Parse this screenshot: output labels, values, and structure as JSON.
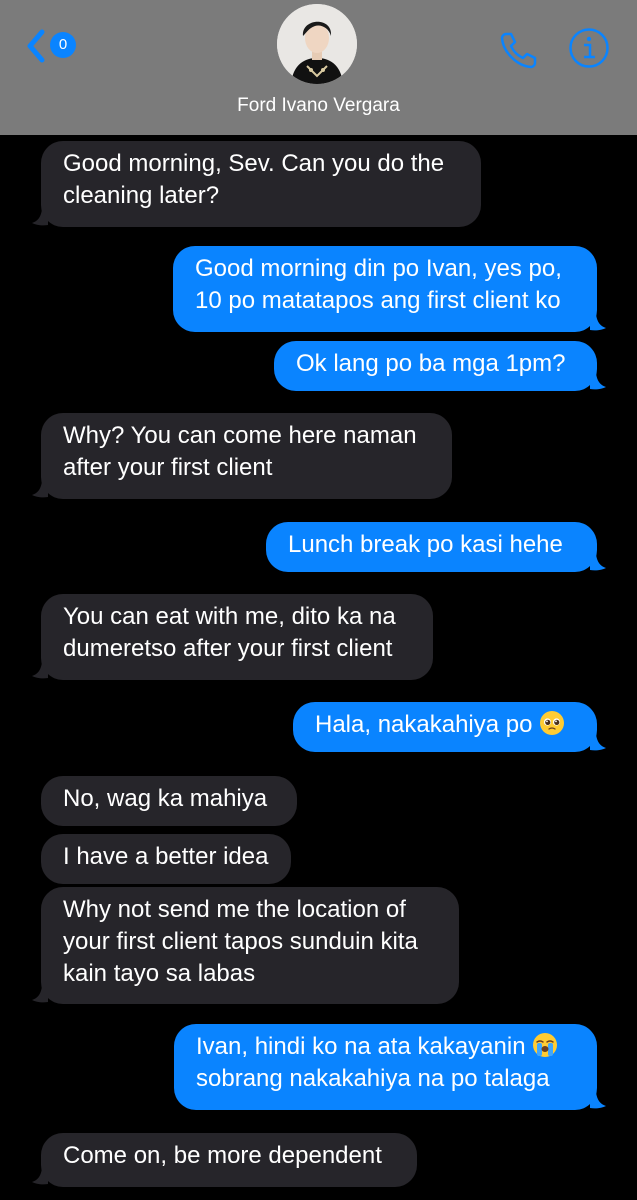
{
  "header": {
    "back_badge": "0",
    "contact_name": "Ford Ivano Vergara"
  },
  "icons": {
    "back": "chevron-left-icon",
    "call": "phone-icon",
    "info": "info-icon",
    "pleading": "pleading-face-emoji",
    "crying": "loudly-crying-face-emoji"
  },
  "colors": {
    "header_bg": "#7b7b7b",
    "incoming_bubble": "#26252a",
    "outgoing_bubble": "#0a84ff",
    "accent": "#0a84ff",
    "background": "#000000"
  },
  "messages": [
    {
      "direction": "incoming",
      "lines": [
        "Good morning, Sev. Can you do the",
        "cleaning later?"
      ]
    },
    {
      "direction": "outgoing",
      "lines": [
        "Good morning din po Ivan, yes po,",
        "10 po matatapos ang first client ko"
      ]
    },
    {
      "direction": "outgoing",
      "lines": [
        "Ok lang po ba mga 1pm?"
      ]
    },
    {
      "direction": "incoming",
      "lines": [
        "Why? You can come here naman",
        "after your first client"
      ]
    },
    {
      "direction": "outgoing",
      "lines": [
        "Lunch break po kasi hehe"
      ]
    },
    {
      "direction": "incoming",
      "lines": [
        "You can eat with me, dito ka na",
        "dumeretso after your first client"
      ]
    },
    {
      "direction": "outgoing",
      "lines": [
        "Hala, nakakahiya po"
      ]
    },
    {
      "direction": "incoming",
      "lines": [
        "No, wag ka mahiya"
      ]
    },
    {
      "direction": "incoming",
      "lines": [
        "I have a better idea"
      ]
    },
    {
      "direction": "incoming",
      "lines": [
        "Why not send me the location of",
        "your first client tapos sunduin kita",
        "kain tayo sa labas"
      ]
    },
    {
      "direction": "outgoing",
      "lines": [
        "Ivan, hindi ko na ata kakayanin",
        "sobrang nakakahiya na po talaga"
      ]
    },
    {
      "direction": "incoming",
      "lines": [
        "Come on, be more dependent"
      ]
    }
  ]
}
